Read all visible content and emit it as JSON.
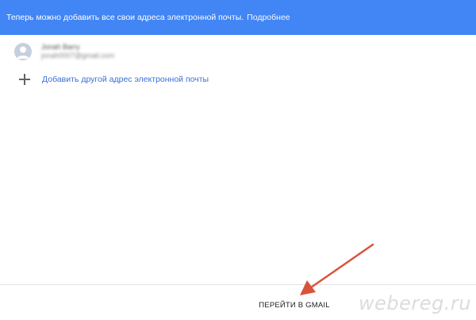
{
  "banner": {
    "message": "Теперь можно добавить все свои адреса электронной почты.",
    "link": "Подробнее",
    "color": "#4285f4"
  },
  "account": {
    "name": "Jonah Barry",
    "email": "jonah0007@gmail.com",
    "avatar_icon": "person-avatar-icon"
  },
  "add_account": {
    "icon": "plus-icon",
    "label": "Добавить другой адрес электронной почты",
    "color": "#3b6fd8"
  },
  "footer": {
    "go_to_gmail_label": "ПЕРЕЙТИ В GMAIL"
  },
  "annotation": {
    "arrow_color": "#d9533b"
  },
  "watermark": {
    "text": "webereg.ru"
  }
}
